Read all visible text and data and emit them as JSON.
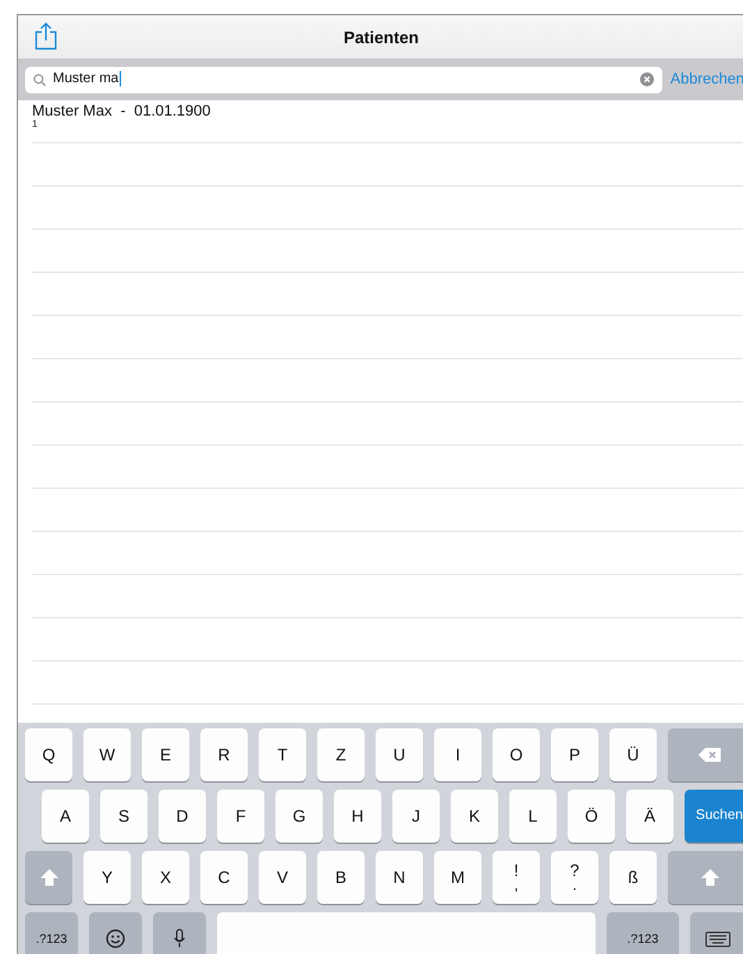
{
  "nav_bar": {
    "title": "Patienten"
  },
  "search": {
    "value": "Muster ma",
    "cancel": "Abbrechen"
  },
  "results": [
    {
      "name": "Muster Max  -  01.01.1900",
      "detail": "1"
    }
  ],
  "keyboard": {
    "key_lines": [
      [
        {
          "kind": "letter",
          "label": "Q"
        },
        {
          "kind": "letter",
          "label": "W"
        },
        {
          "kind": "letter",
          "label": "E"
        },
        {
          "kind": "letter",
          "label": "R"
        },
        {
          "kind": "letter",
          "label": "T"
        },
        {
          "kind": "letter",
          "label": "Z"
        },
        {
          "kind": "letter",
          "label": "U"
        },
        {
          "kind": "letter",
          "label": "I"
        },
        {
          "kind": "letter",
          "label": "O"
        },
        {
          "kind": "letter",
          "label": "P"
        },
        {
          "kind": "letter",
          "label": "Ü"
        },
        {
          "kind": "backspace"
        }
      ],
      [
        {
          "kind": "letter",
          "label": "A"
        },
        {
          "kind": "letter",
          "label": "S"
        },
        {
          "kind": "letter",
          "label": "D"
        },
        {
          "kind": "letter",
          "label": "F"
        },
        {
          "kind": "letter",
          "label": "G"
        },
        {
          "kind": "letter",
          "label": "H"
        },
        {
          "kind": "letter",
          "label": "J"
        },
        {
          "kind": "letter",
          "label": "K"
        },
        {
          "kind": "letter",
          "label": "L"
        },
        {
          "kind": "letter",
          "label": "Ö"
        },
        {
          "kind": "letter",
          "label": "Ä"
        },
        {
          "kind": "action",
          "label": "Suchen"
        }
      ],
      [
        {
          "kind": "shift"
        },
        {
          "kind": "letter",
          "label": "Y"
        },
        {
          "kind": "letter",
          "label": "X"
        },
        {
          "kind": "letter",
          "label": "C"
        },
        {
          "kind": "letter",
          "label": "V"
        },
        {
          "kind": "letter",
          "label": "B"
        },
        {
          "kind": "letter",
          "label": "N"
        },
        {
          "kind": "letter",
          "label": "M"
        },
        {
          "kind": "letter",
          "label": "!",
          "sub": ","
        },
        {
          "kind": "letter",
          "label": "?",
          "sub": "."
        },
        {
          "kind": "letter",
          "label": "ß"
        },
        {
          "kind": "shift"
        }
      ],
      [
        {
          "kind": "mode",
          "label": ".?123"
        },
        {
          "kind": "emoji"
        },
        {
          "kind": "mic"
        },
        {
          "kind": "space"
        },
        {
          "kind": "mode",
          "label": ".?123"
        },
        {
          "kind": "dismiss"
        }
      ]
    ]
  }
}
